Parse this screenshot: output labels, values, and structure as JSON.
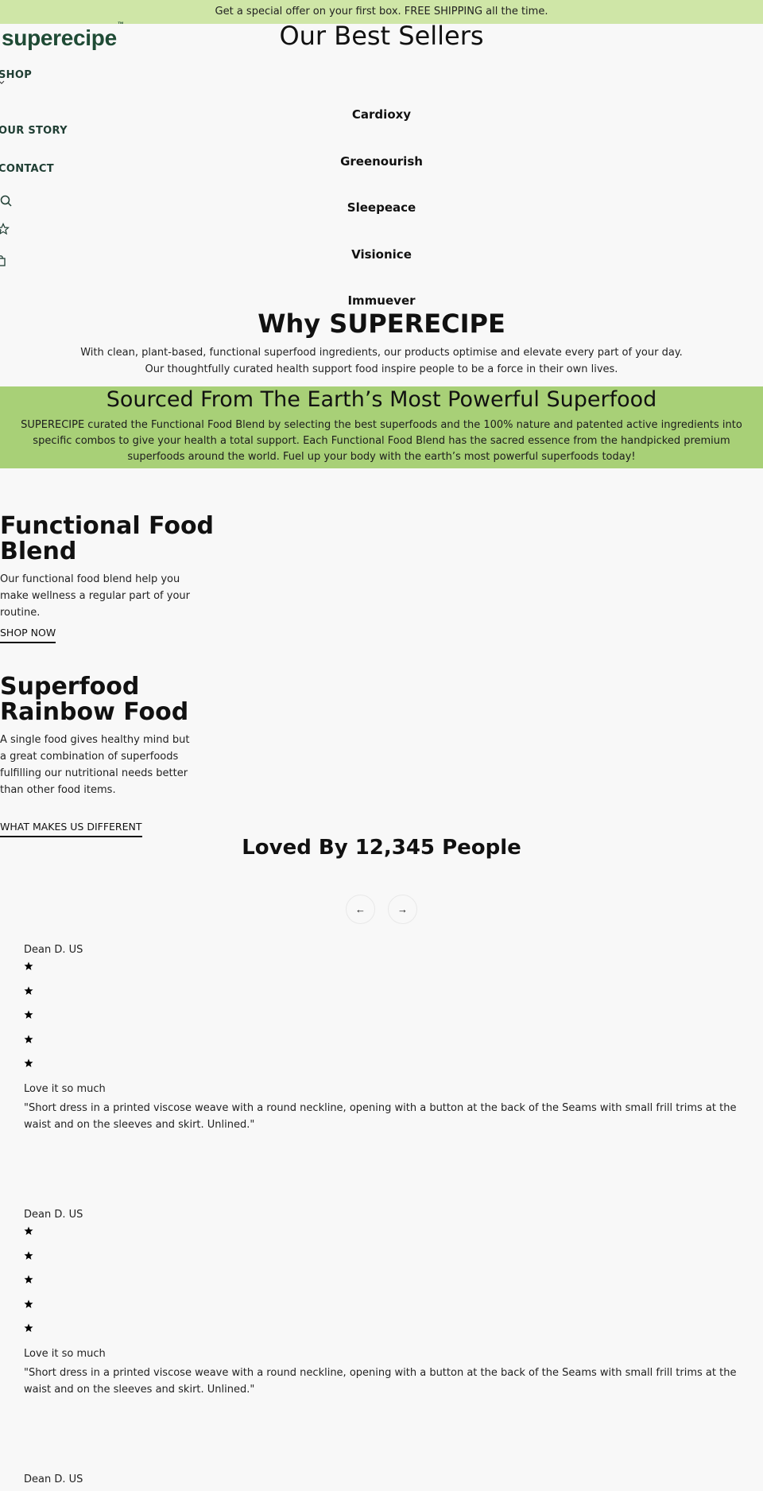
{
  "announcement": "Get a special offer on your first box. FREE SHIPPING all the time.",
  "brand": {
    "name": "superecipe",
    "trademark": "™",
    "color": "#1f4b35"
  },
  "nav": {
    "items": [
      {
        "label": "SHOP",
        "has_dropdown": true
      },
      {
        "label": "OUR STORY"
      },
      {
        "label": "CONTACT"
      }
    ],
    "icons": [
      "search-icon",
      "star-icon",
      "bag-icon"
    ]
  },
  "best_sellers": {
    "title": "Our Best Sellers",
    "products": [
      "Cardioxy",
      "Greenourish",
      "Sleepeace",
      "Visionice",
      "Immuever"
    ]
  },
  "why": {
    "title": "Why SUPERECIPE",
    "lines": [
      "With clean, plant-based, functional superfood ingredients, our products optimise and elevate every part of your day.",
      "Our thoughtfully curated health support food inspire people to be a force in their own lives."
    ]
  },
  "sourced": {
    "title": "Sourced From The Earth’s Most Powerful Superfood",
    "text": "SUPERECIPE curated the Functional Food Blend by selecting the best superfoods and the 100% nature and patented active ingredients into specific combos to give your health a total support. Each Functional Food Blend has the sacred essence from the handpicked premium superfoods around the world. Fuel up your body with the earth’s most powerful superfoods today!",
    "background": "#a8d077"
  },
  "features": [
    {
      "title": "Functional Food Blend",
      "text": "Our functional food blend help you make wellness a regular part of your routine.",
      "link": "SHOP NOW"
    },
    {
      "title": "Superfood Rainbow Food",
      "text": "A single food gives healthy mind but a great combination of superfoods fulfilling our nutritional needs better than other food items.",
      "link": "WHAT MAKES US DIFFERENT"
    }
  ],
  "reviews": {
    "title": "Loved By 12,345 People",
    "prev_label": "←",
    "next_label": "→",
    "items": [
      {
        "author": "Dean D. US",
        "rating": 5,
        "title": "Love it so much",
        "body": "\"Short dress in a printed viscose weave with a round neckline, opening with a button at the back of the Seams with small frill trims at the waist and on the sleeves and skirt. Unlined.\""
      },
      {
        "author": "Dean D. US",
        "rating": 5,
        "title": "Love it so much",
        "body": "\"Short dress in a printed viscose weave with a round neckline, opening with a button at the back of the Seams with small frill trims at the waist and on the sleeves and skirt. Unlined.\""
      },
      {
        "author": "Dean D. US"
      }
    ]
  }
}
